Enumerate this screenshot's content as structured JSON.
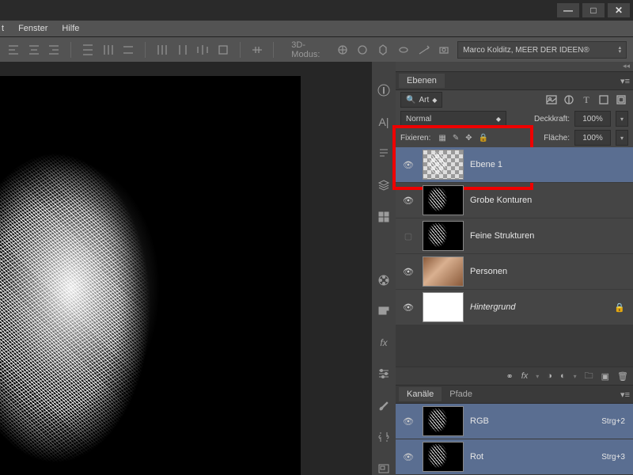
{
  "menu": {
    "fenster": "Fenster",
    "hilfe": "Hilfe"
  },
  "options": {
    "mode_label": "3D-Modus:",
    "user_dd": "Marco Kolditz, MEER DER IDEEN®"
  },
  "layers_panel": {
    "tab": "Ebenen",
    "kind_label": "Art",
    "blend_mode": "Normal",
    "opacity_label": "Deckkraft:",
    "opacity_value": "100%",
    "fill_label": "Fläche:",
    "fill_value": "100%",
    "lock_label": "Fixieren:"
  },
  "layers": [
    {
      "name": "Ebene 1"
    },
    {
      "name": "Grobe Konturen"
    },
    {
      "name": "Feine Strukturen"
    },
    {
      "name": "Personen"
    },
    {
      "name": "Hintergrund"
    }
  ],
  "channels_panel": {
    "tab": "Kanäle",
    "tab2": "Pfade",
    "items": [
      {
        "name": "RGB",
        "shortcut": "Strg+2"
      },
      {
        "name": "Rot",
        "shortcut": "Strg+3"
      }
    ]
  },
  "buttons": {
    "fx": "fx"
  }
}
